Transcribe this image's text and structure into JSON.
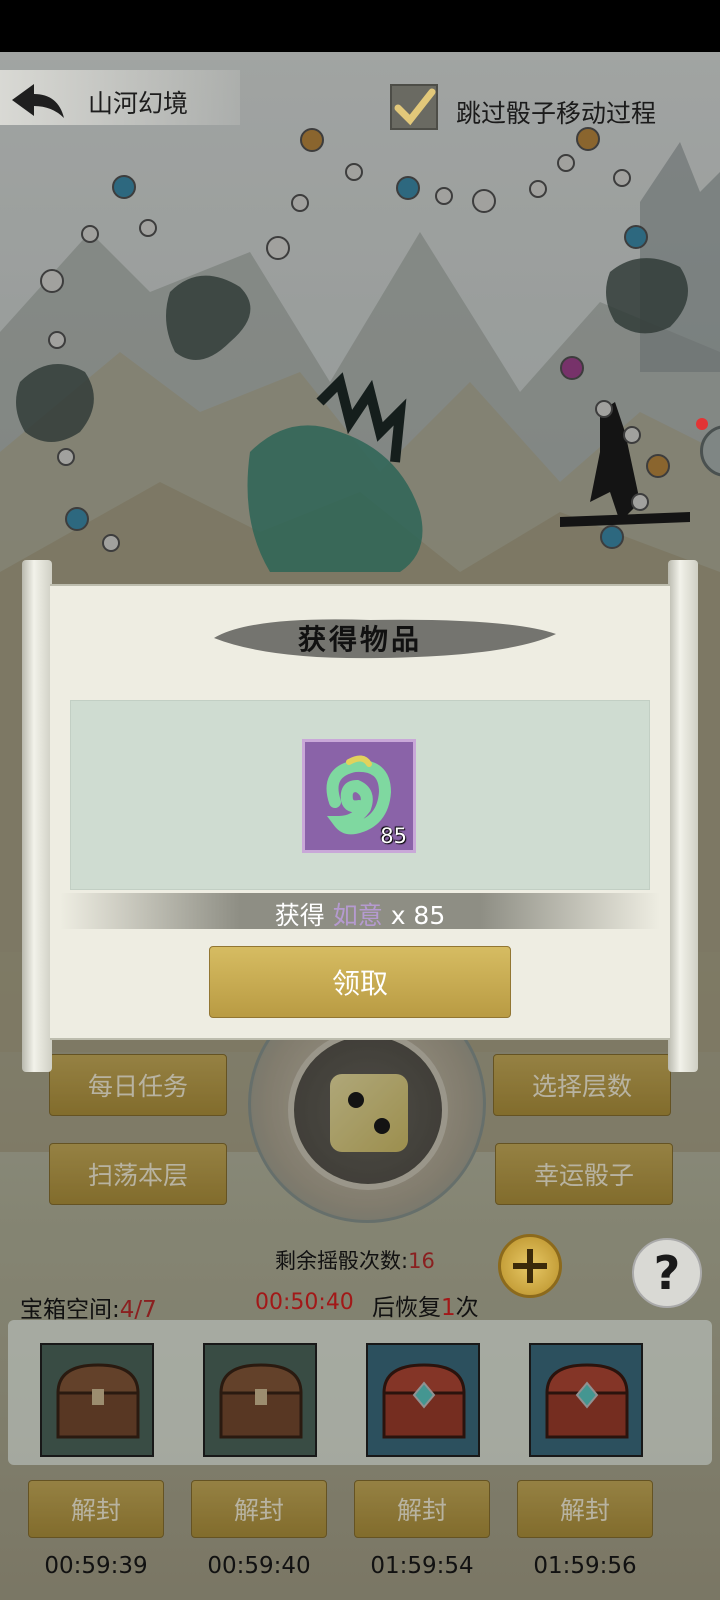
{
  "header": {
    "title": "山河幻境",
    "skip_label": "跳过骰子移动过程",
    "skip_checked": true
  },
  "dialog": {
    "title": "获得物品",
    "item": {
      "name": "如意",
      "count": "85",
      "icon": "jade-ruyi-icon"
    },
    "gain_prefix": "获得",
    "gain_item": "如意",
    "gain_suffix": "x 85",
    "claim_label": "领取"
  },
  "buttons": {
    "daily_tasks": "每日任务",
    "sweep_floor": "扫荡本层",
    "select_floor": "选择层数",
    "lucky_dice": "幸运骰子"
  },
  "dice": {
    "face": 2
  },
  "status": {
    "rolls_label": "剩余摇骰次数:",
    "rolls_value": "16",
    "chest_space_label": "宝箱空间:",
    "chest_space_value": "4/7",
    "recover_timer": "00:50:40",
    "recover_prefix": "后恢复",
    "recover_count": "1",
    "recover_suffix": "次"
  },
  "chests": [
    {
      "type": "wooden-chest-icon",
      "unseal_label": "解封",
      "time": "00:59:39"
    },
    {
      "type": "wooden-chest-icon",
      "unseal_label": "解封",
      "time": "00:59:40"
    },
    {
      "type": "red-gem-chest-icon",
      "unseal_label": "解封",
      "time": "01:59:54"
    },
    {
      "type": "red-gem-chest-icon",
      "unseal_label": "解封",
      "time": "01:59:56"
    }
  ],
  "colors": {
    "gold_button": "#c4a74f",
    "item_purple": "#8a63a8",
    "timer_red": "#a21818",
    "dot_gray": "#e0e0dc",
    "dot_blue": "#3f90b0",
    "dot_orange": "#c08c40",
    "dot_purple": "#a64694"
  }
}
